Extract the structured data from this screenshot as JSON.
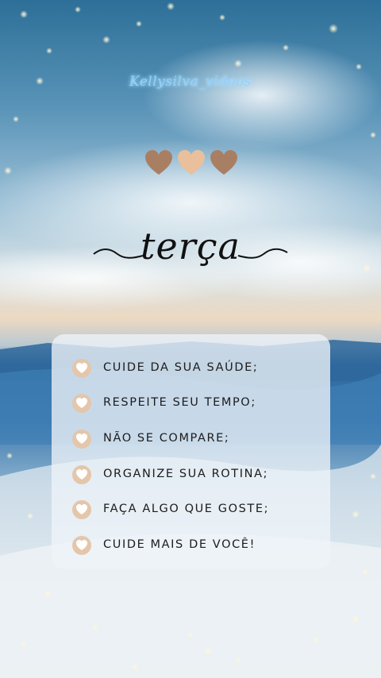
{
  "watermark": "Kellysilva_videos",
  "day": "terça",
  "colors": {
    "heart_dark": "#a97f64",
    "heart_light": "#e9c09b",
    "icon": "#e4c6ab",
    "card": "#eef4f9",
    "title": "#111111"
  },
  "tips": [
    {
      "icon": "heart-check-icon",
      "label": "CUIDE DA SUA SAÚDE;"
    },
    {
      "icon": "heart-check-icon",
      "label": "RESPEITE SEU TEMPO;"
    },
    {
      "icon": "heart-check-icon",
      "label": "NÃO SE COMPARE;"
    },
    {
      "icon": "heart-check-icon",
      "label": "ORGANIZE SUA ROTINA;"
    },
    {
      "icon": "heart-check-icon",
      "label": "FAÇA ALGO QUE GOSTE;"
    },
    {
      "icon": "heart-check-icon",
      "label": "CUIDE MAIS DE VOCÊ!"
    }
  ]
}
